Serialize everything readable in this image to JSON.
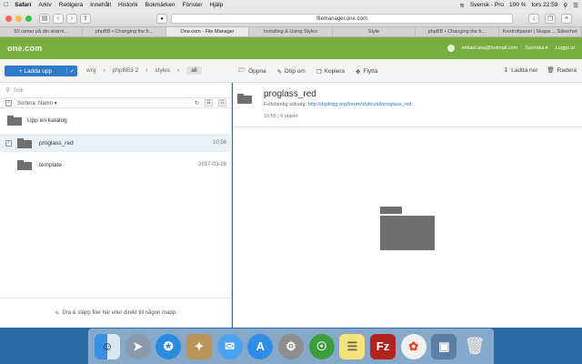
{
  "menubar": {
    "items": [
      "Safari",
      "Arkiv",
      "Redigera",
      "Innehåll",
      "Historik",
      "Bokmärken",
      "Fönster",
      "Hjälp"
    ],
    "lang": "Svensk - Pro",
    "battery": "100 %",
    "clock": "tors 22:59"
  },
  "toolbar": {
    "url": "filemanager.one.com"
  },
  "tabs": [
    "55 ramar på din skärm...",
    "phpBB • Changing the fr...",
    "One.com - File Manager",
    "Installing & Using Styles",
    "Style",
    "phpBB • Changing the fr...",
    "Kontrollpanel | Skapa ... Säkerhet"
  ],
  "header": {
    "logo": "one.com",
    "user": "mikael.asa@hotmail.com",
    "language": "Svenska ▾",
    "logout": "Logga ut"
  },
  "actionbar": {
    "upload": "+ Ladda upp",
    "crumbs": [
      "wrg",
      "phpBB3 2",
      "styles",
      "all"
    ],
    "actions": [
      "Öppna",
      "Döp om",
      "Kopiera",
      "Flytta"
    ],
    "right": [
      "Ladda ner",
      "Radera"
    ]
  },
  "left": {
    "search_placeholder": "Sök",
    "sort_label": "Sortera: Namn ▾",
    "up_label": "Upp en katalog",
    "rows": [
      {
        "name": "proglass_red",
        "date": "10:56"
      },
      {
        "name": "template",
        "date": "2017-03-28"
      }
    ],
    "dropzone": "Dra & släpp filer här eller direkt till någon mapp."
  },
  "detail": {
    "title": "proglass_red",
    "path_label": "Fullständig sökväg:",
    "path_link": "http://digilogg.org/forum/styles/all/proglass_red",
    "meta": "10:55   |   6 objekt"
  }
}
